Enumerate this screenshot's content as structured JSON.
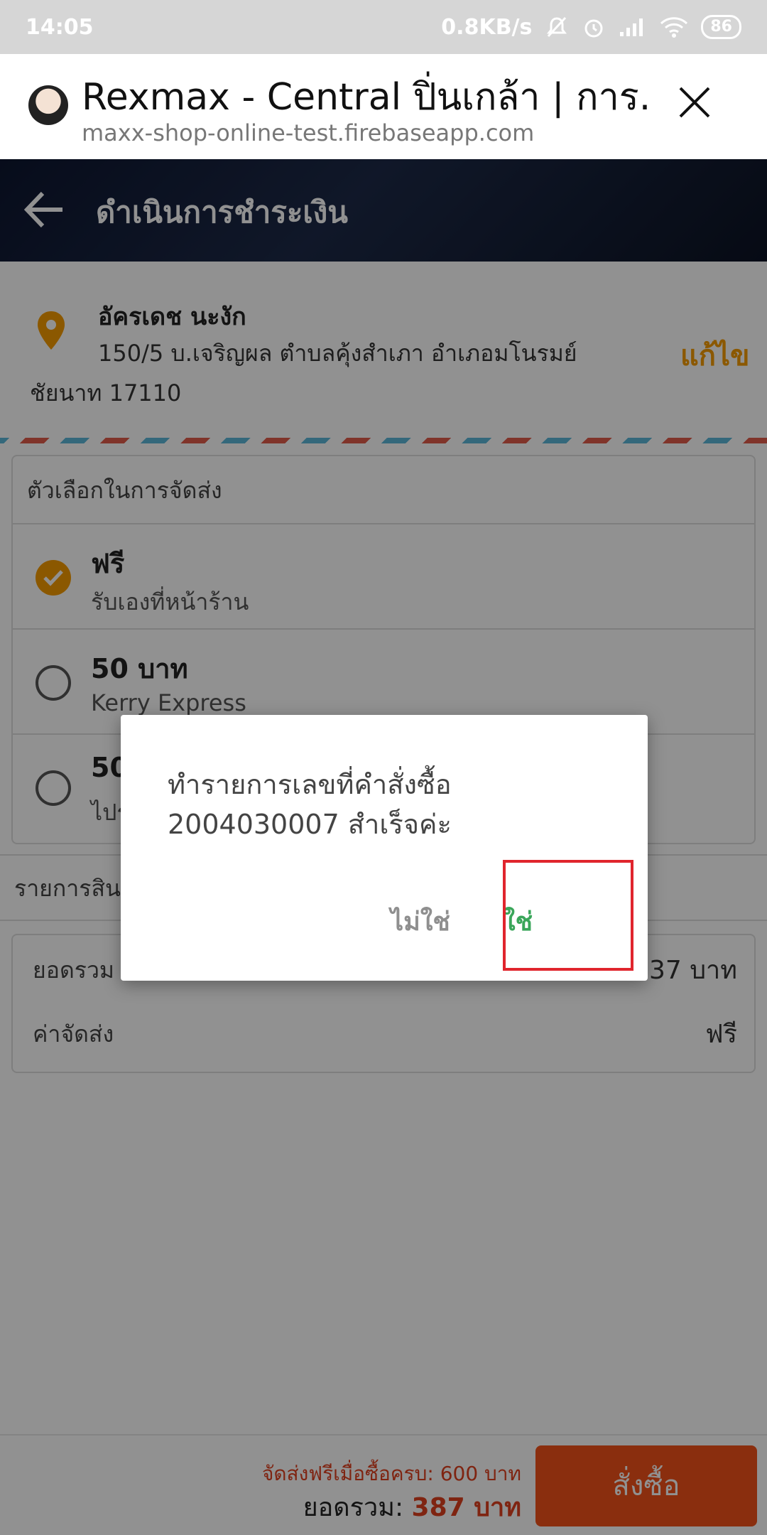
{
  "status_bar": {
    "time": "14:05",
    "net_speed": "0.8KB/s",
    "battery": "86"
  },
  "browser_tab": {
    "title": "Rexmax - Central ปิ่นเกล้า | การ...",
    "url": "maxx-shop-online-test.firebaseapp.com"
  },
  "header": {
    "title": "ดำเนินการชำระเงิน"
  },
  "address": {
    "name": "อัครเดช นะงัก",
    "line1": "150/5 บ.เจริญผล ตำบลคุ้งสำเภา อำเภอมโนรมย์",
    "line2": "ชัยนาท 17110",
    "edit_label": "แก้ไข",
    "accent": "#f59b00"
  },
  "shipping": {
    "heading": "ตัวเลือกในการจัดส่ง",
    "options": [
      {
        "price": "ฟรี",
        "desc": "รับเองที่หน้าร้าน",
        "selected": true
      },
      {
        "price": "50 บาท",
        "desc": "Kerry Express",
        "selected": false
      },
      {
        "price": "50",
        "desc": "ไปร",
        "selected": false
      }
    ]
  },
  "items": {
    "heading": "รายการสิน"
  },
  "summary": {
    "subtotal_label": "ยอดรวม (",
    "subtotal_value": "37 บาท",
    "shipping_label": "ค่าจัดส่ง",
    "shipping_value": "ฟรี"
  },
  "bottom": {
    "free_note": "จัดส่งฟรีเมื่อซื้อครบ: 600 บาท",
    "total_label": "ยอดรวม: ",
    "total_value": "387 บาท",
    "order_label": "สั่งซื้อ",
    "button_color": "#f2521a"
  },
  "dialog": {
    "message_line1": "ทำรายการเลขที่คำสั่งซื้อ",
    "message_line2": "2004030007 สำเร็จค่ะ",
    "no_label": "ไม่ใช่",
    "yes_label": "ใช่",
    "yes_color": "#3aa65a"
  }
}
